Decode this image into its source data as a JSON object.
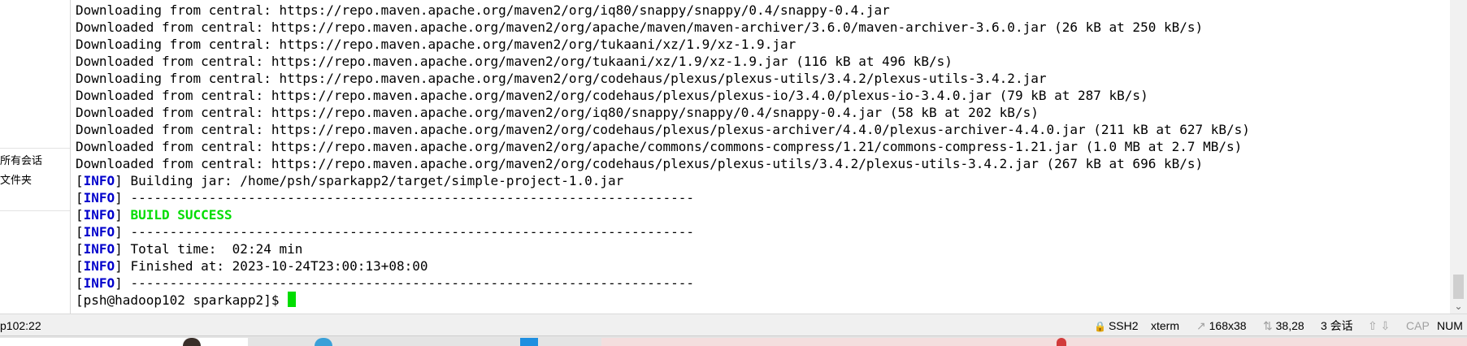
{
  "sidebar": {
    "items": [
      {
        "label": "所有会话"
      },
      {
        "label": "文件夹"
      }
    ]
  },
  "terminal": {
    "lines": [
      "Downloading from central: https://repo.maven.apache.org/maven2/org/iq80/snappy/snappy/0.4/snappy-0.4.jar",
      "Downloaded from central: https://repo.maven.apache.org/maven2/org/apache/maven/maven-archiver/3.6.0/maven-archiver-3.6.0.jar (26 kB at 250 kB/s)",
      "Downloading from central: https://repo.maven.apache.org/maven2/org/tukaani/xz/1.9/xz-1.9.jar",
      "Downloaded from central: https://repo.maven.apache.org/maven2/org/tukaani/xz/1.9/xz-1.9.jar (116 kB at 496 kB/s)",
      "Downloading from central: https://repo.maven.apache.org/maven2/org/codehaus/plexus/plexus-utils/3.4.2/plexus-utils-3.4.2.jar",
      "Downloaded from central: https://repo.maven.apache.org/maven2/org/codehaus/plexus/plexus-io/3.4.0/plexus-io-3.4.0.jar (79 kB at 287 kB/s)",
      "Downloaded from central: https://repo.maven.apache.org/maven2/org/iq80/snappy/snappy/0.4/snappy-0.4.jar (58 kB at 202 kB/s)",
      "Downloaded from central: https://repo.maven.apache.org/maven2/org/codehaus/plexus/plexus-archiver/4.4.0/plexus-archiver-4.4.0.jar (211 kB at 627 kB/s)",
      "Downloaded from central: https://repo.maven.apache.org/maven2/org/apache/commons/commons-compress/1.21/commons-compress-1.21.jar (1.0 MB at 2.7 MB/s)",
      "Downloaded from central: https://repo.maven.apache.org/maven2/org/codehaus/plexus/plexus-utils/3.4.2/plexus-utils-3.4.2.jar (267 kB at 696 kB/s)"
    ],
    "info_tag": "INFO",
    "info_lines": [
      " Building jar: /home/psh/sparkapp2/target/simple-project-1.0.jar",
      " ------------------------------------------------------------------------",
      " BUILD SUCCESS",
      " ------------------------------------------------------------------------",
      " Total time:  02:24 min",
      " Finished at: 2023-10-24T23:00:13+08:00",
      " ------------------------------------------------------------------------"
    ],
    "prompt": "[psh@hadoop102 sparkapp2]$ "
  },
  "statusbar": {
    "left_text": "p102:22",
    "protocol": "SSH2",
    "terminal_type": "xterm",
    "size": "168x38",
    "cursor_pos": "38,28",
    "sessions": "3 会话",
    "cap": "CAP",
    "num": "NUM"
  },
  "colors": {
    "info": "#0000cc",
    "success": "#00dd00",
    "cursor": "#00dd00"
  }
}
